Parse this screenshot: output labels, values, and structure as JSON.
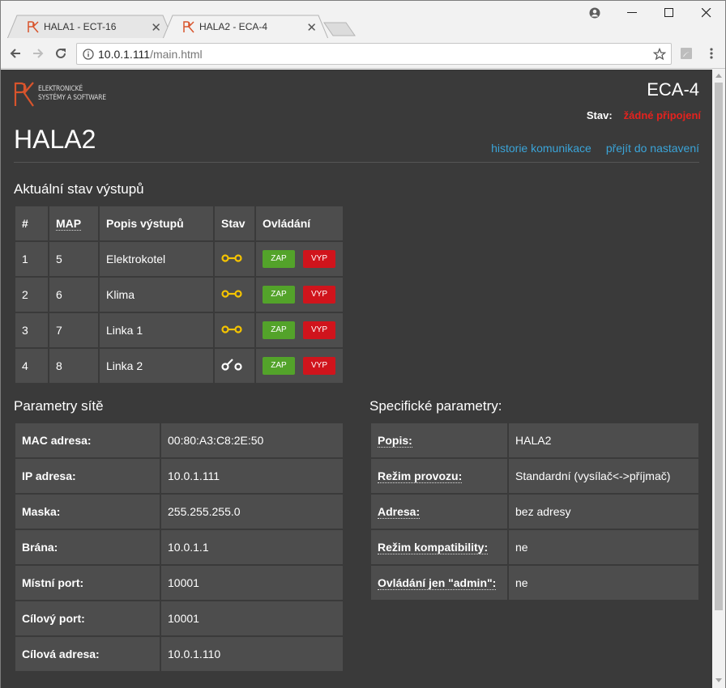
{
  "browser": {
    "tabs": [
      {
        "title": "HALA1 - ECT-16",
        "active": false
      },
      {
        "title": "HALA2 - ECA-4",
        "active": true
      }
    ],
    "url_host": "10.0.1.111",
    "url_path": "/main.html"
  },
  "header": {
    "logo_line1": "ELEKTRONICKÉ",
    "logo_line2": "SYSTÉMY A SOFTWARE",
    "device": "ECA-4",
    "status_label": "Stav:",
    "status_value": "žádné připojení",
    "status_color": "#e5221e",
    "page_title": "HALA2",
    "link_history": "historie komunikace",
    "link_settings": "přejít do nastavení",
    "link_color": "#3aa4d8"
  },
  "outputs": {
    "heading": "Aktuální stav výstupů",
    "columns": [
      "#",
      "MAP",
      "Popis výstupů",
      "Stav",
      "Ovládání"
    ],
    "on_label": "ZAP",
    "off_label": "VYP",
    "rows": [
      {
        "num": "1",
        "map": "5",
        "desc": "Elektrokotel",
        "state": "closed"
      },
      {
        "num": "2",
        "map": "6",
        "desc": "Klima",
        "state": "closed"
      },
      {
        "num": "3",
        "map": "7",
        "desc": "Linka 1",
        "state": "closed"
      },
      {
        "num": "4",
        "map": "8",
        "desc": "Linka 2",
        "state": "open"
      }
    ]
  },
  "network": {
    "heading": "Parametry sítě",
    "rows": [
      {
        "label": "MAC adresa:",
        "value": "00:80:A3:C8:2E:50"
      },
      {
        "label": "IP adresa:",
        "value": "10.0.1.111"
      },
      {
        "label": "Maska:",
        "value": "255.255.255.0"
      },
      {
        "label": "Brána:",
        "value": "10.0.1.1"
      },
      {
        "label": "Místní port:",
        "value": "10001"
      },
      {
        "label": "Cílový port:",
        "value": "10001"
      },
      {
        "label": "Cílová adresa:",
        "value": "10.0.1.110"
      }
    ]
  },
  "specific": {
    "heading": "Specifické parametry:",
    "rows": [
      {
        "label": "Popis:",
        "value": "HALA2"
      },
      {
        "label": "Režim provozu:",
        "value": "Standardní (vysílač<->příjmač)"
      },
      {
        "label": "Adresa:",
        "value": "bez adresy"
      },
      {
        "label": "Režim kompatibility:",
        "value": "ne"
      },
      {
        "label": "Ovládání jen \"admin\":",
        "value": "ne"
      }
    ]
  }
}
